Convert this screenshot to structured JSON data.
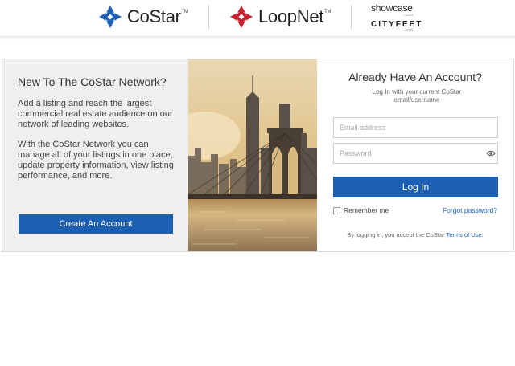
{
  "header": {
    "brands": [
      {
        "name": "CoStar",
        "tm": "TM",
        "icon": "costar-logo-icon",
        "color": "#1d5fb3"
      },
      {
        "name": "LoopNet",
        "tm": "TM",
        "icon": "loopnet-logo-icon",
        "color": "#c8202f"
      }
    ],
    "showcase": {
      "name": "showcase",
      "suffix": ".com"
    },
    "cityfeet": {
      "name": "CITYFEET",
      "suffix": ".com"
    }
  },
  "left_panel": {
    "title": "New To The CoStar Network?",
    "paragraph1": "Add a listing and reach the largest commercial real estate audience on our network of leading websites.",
    "paragraph2": "With the CoStar Network you can manage all of your listings in one place, update property information, view listing performance, and more.",
    "create_button": "Create An Account"
  },
  "login": {
    "title": "Already Have An Account?",
    "subtitle": "Log In with your current CoStar email/username",
    "email_placeholder": "Email address",
    "password_placeholder": "Password",
    "login_button": "Log In",
    "remember_label": "Remember me",
    "forgot_link": "Forgot password?",
    "terms_prefix": "By logging in, you accept the CoStar ",
    "terms_link": "Terms of Use.",
    "show_password_icon": "eye-icon"
  },
  "colors": {
    "accent": "#1d5fb3",
    "loopnet_red": "#c8202f",
    "panel_gray": "#efefef"
  }
}
